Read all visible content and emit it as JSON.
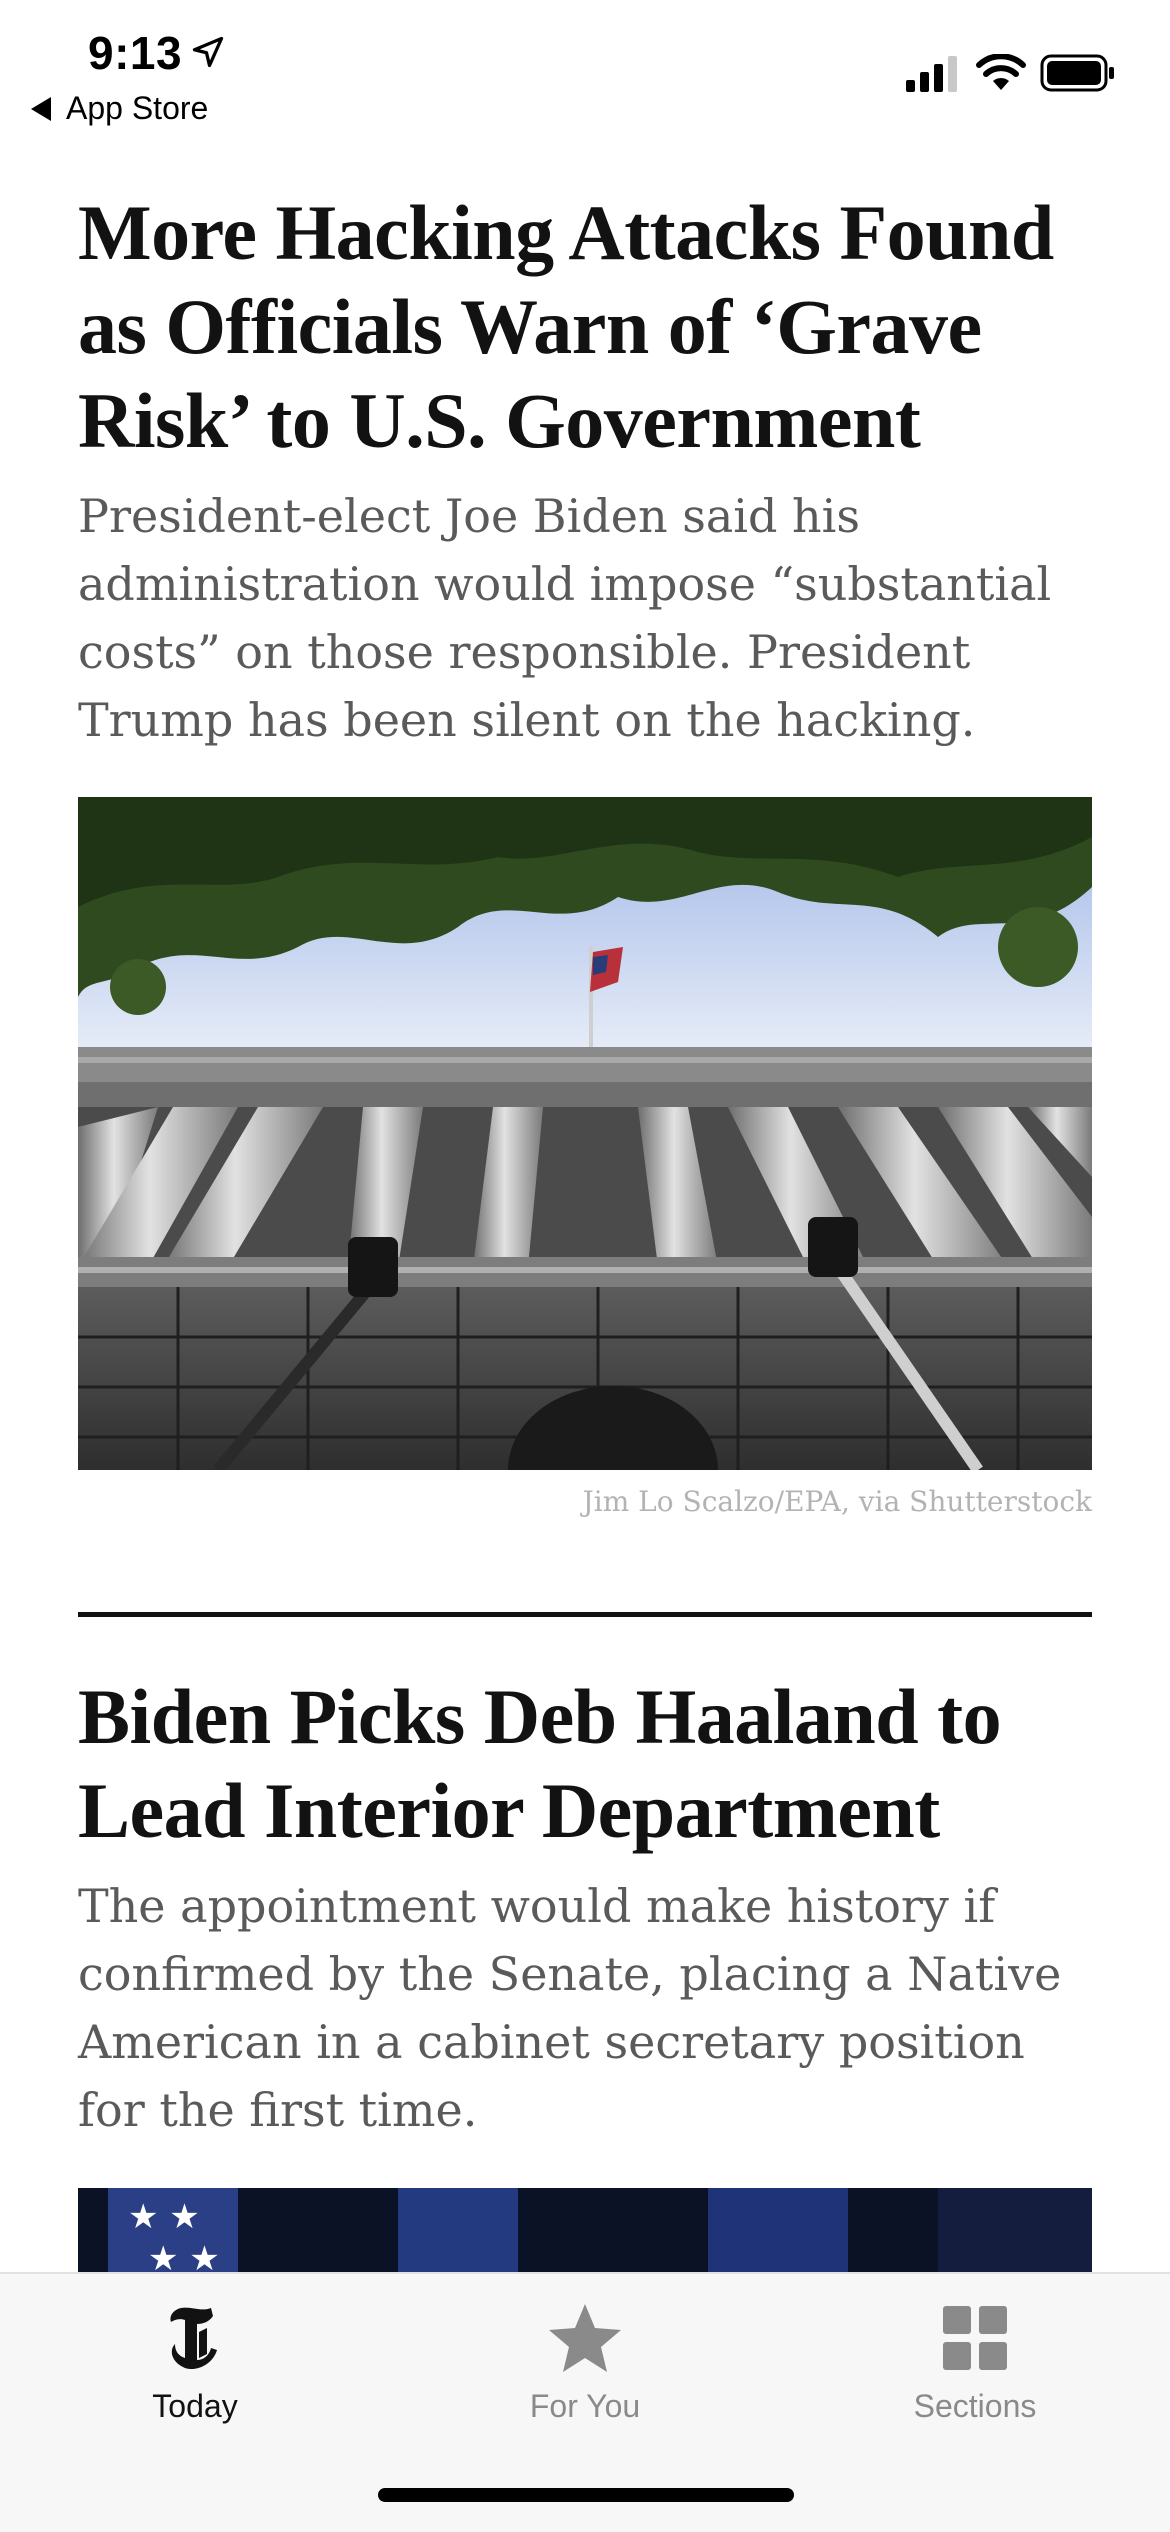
{
  "status_bar": {
    "time": "9:13",
    "back_label": "App Store"
  },
  "articles": [
    {
      "headline": "More Hacking Attacks Found as Officials Warn of ‘Grave Risk’ to U.S. Government",
      "summary": "President-elect Joe Biden said his administration would impose “substantial costs” on those responsible. President Trump has been silent on the hacking.",
      "photo_credit": "Jim Lo Scalzo/EPA, via Shutterstock"
    },
    {
      "headline": "Biden Picks Deb Haaland to Lead Interior Department",
      "summary": "The appointment would make history if confirmed by the Senate, placing a Native American in a cabinet secretary position for the first time."
    }
  ],
  "tab_bar": {
    "tabs": [
      {
        "label": "Today",
        "icon": "nyt-logo-icon",
        "active": true
      },
      {
        "label": "For You",
        "icon": "star-icon",
        "active": false
      },
      {
        "label": "Sections",
        "icon": "grid-icon",
        "active": false
      }
    ],
    "active_color": "#121212",
    "inactive_color": "#8a8a8a"
  }
}
